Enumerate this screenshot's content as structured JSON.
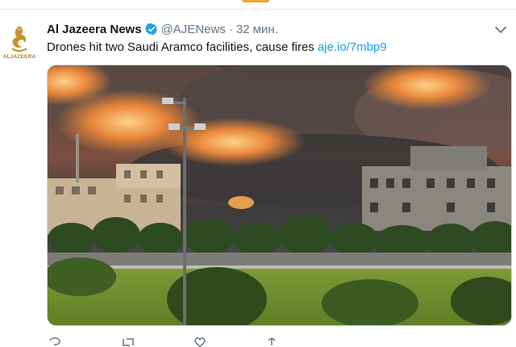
{
  "tweet": {
    "display_name": "Al Jazeera News",
    "handle": "@AJENews",
    "separator": "·",
    "time": "32 мин.",
    "text": "Drones hit two Saudi Aramco facilities, cause fires",
    "link": "aje.io/7mbp9",
    "avatar_caption": "ALJAZEERA",
    "accent_color": "#1da1f2"
  },
  "icons": {
    "verified": "verified-badge-icon",
    "more": "chevron-down-icon",
    "reply": "reply-icon",
    "retweet": "retweet-icon",
    "like": "heart-icon",
    "share": "share-icon"
  },
  "media": {
    "description_colors": {
      "smoke": "#3a3a3a",
      "fire": "#e8873a",
      "grass": "#6e8f2e"
    }
  }
}
